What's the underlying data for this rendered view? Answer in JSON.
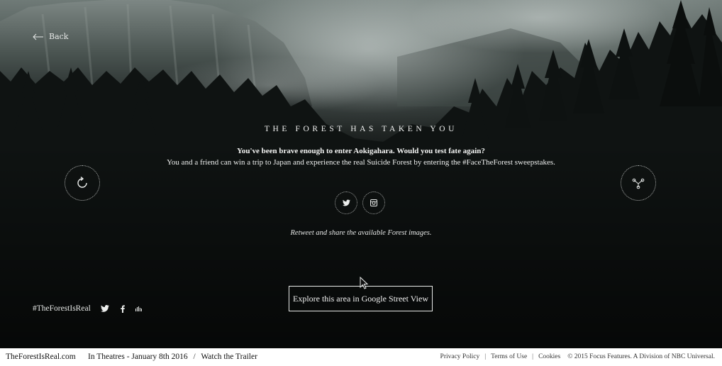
{
  "nav": {
    "back_label": "Back"
  },
  "hero": {
    "headline": "THE FOREST HAS TAKEN YOU",
    "lead": "You've been brave enough to enter Aokigahara. Would you test fate again?",
    "sub": "You and a friend can win a trip to Japan and experience the real Suicide Forest by entering the #FaceTheForest sweepstakes.",
    "share_hint": "Retweet and share the available Forest images.",
    "cta_label": "Explore this area in Google Street View"
  },
  "controls": {
    "left_icon": "refresh-icon",
    "right_icon": "share-network-icon",
    "social_icons": [
      "twitter-icon",
      "instagram-icon"
    ]
  },
  "bottom_bar": {
    "hashtag": "#TheForestIsReal",
    "share_icons": [
      "twitter-icon",
      "facebook-icon",
      "soundcloud-icon"
    ]
  },
  "footer": {
    "brand": "TheForestIsReal.com",
    "release": "In Theatres - January 8th 2016",
    "separator": "/",
    "trailer": "Watch the Trailer",
    "privacy": "Privacy Policy",
    "terms": "Terms of Use",
    "cookies": "Cookies",
    "copyright": "© 2015 Focus Features. A Division of NBC Universal."
  },
  "colors": {
    "background": "#0a0b0b",
    "text": "#e9ebea",
    "footer_bg": "#ffffff",
    "footer_text": "#1b1b1b"
  }
}
